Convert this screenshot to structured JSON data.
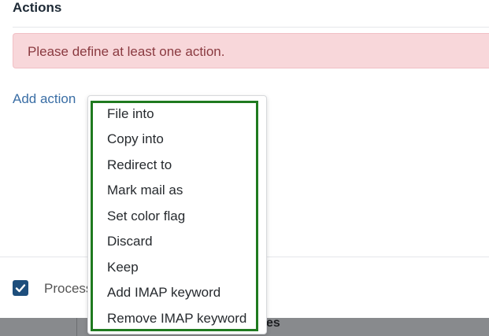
{
  "section": {
    "title": "Actions"
  },
  "alert": {
    "message": "Please define at least one action."
  },
  "add_action": {
    "label": "Add action"
  },
  "dropdown": {
    "items": [
      "File into",
      "Copy into",
      "Redirect to",
      "Mark mail as",
      "Set color flag",
      "Discard",
      "Keep",
      "Add IMAP keyword",
      "Remove IMAP keyword"
    ]
  },
  "process": {
    "label": "Process",
    "checked": true
  },
  "background_band": {
    "partial_text": "es"
  },
  "colors": {
    "alert_bg": "#f8d7da",
    "alert_text": "#8a3a40",
    "link": "#3a6ea5",
    "checkbox": "#1d4e7c",
    "highlight": "#1f7a1f"
  }
}
